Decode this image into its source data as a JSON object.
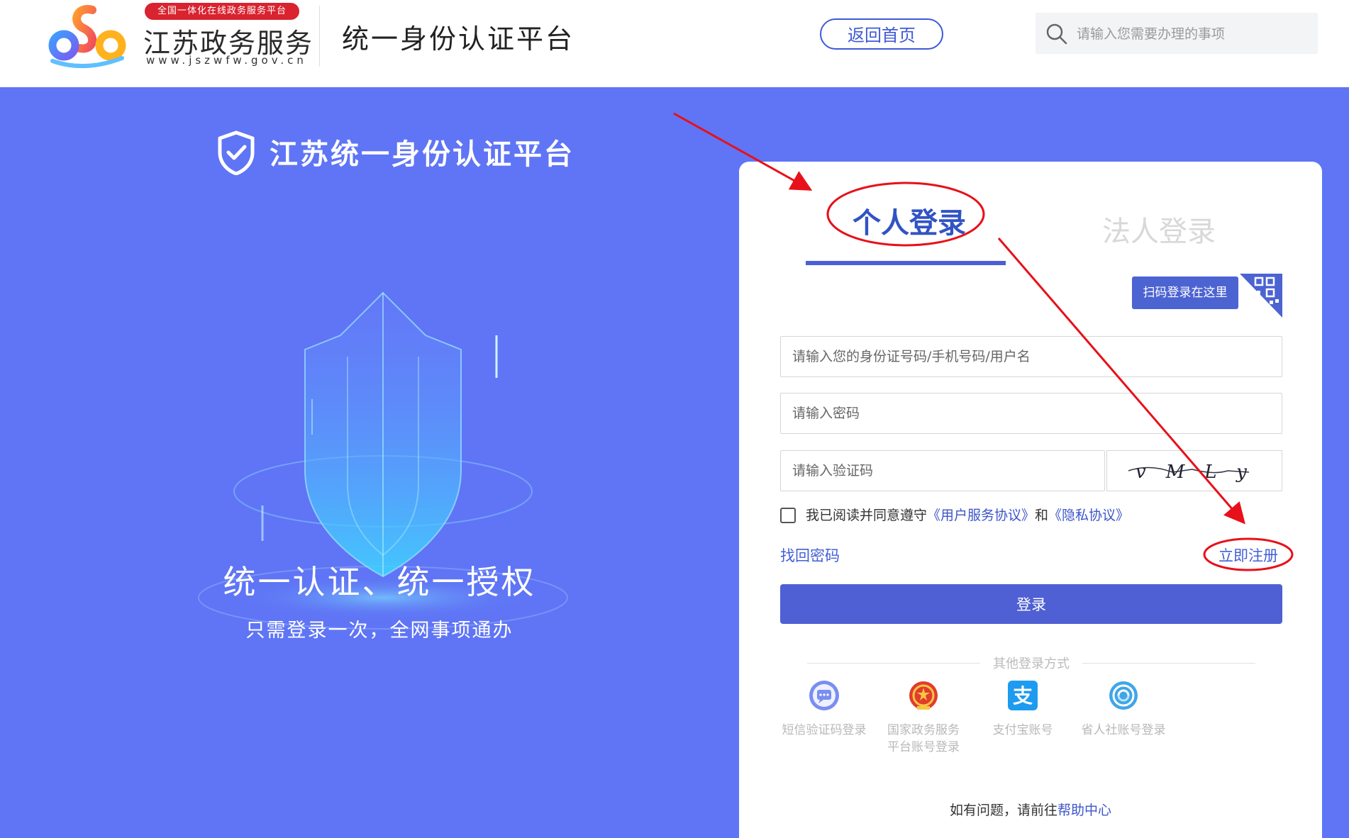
{
  "header": {
    "logo_badge": "全国一体化在线政务服务平台",
    "logo_title": "江苏政务服务",
    "logo_url": "www.jszwfw.gov.cn",
    "platform_title": "统一身份认证平台",
    "home_button": "返回首页",
    "search_placeholder": "请输入您需要办理的事项"
  },
  "hero": {
    "title": "江苏统一身份认证平台",
    "slogan": "统一认证、统一授权",
    "subtitle": "只需登录一次，全网事项通办"
  },
  "login": {
    "tabs": [
      {
        "label": "个人登录",
        "active": true
      },
      {
        "label": "法人登录",
        "active": false
      }
    ],
    "qr_badge": "扫码登录在这里",
    "username_placeholder": "请输入您的身份证号码/手机号码/用户名",
    "password_placeholder": "请输入密码",
    "captcha_placeholder": "请输入验证码",
    "captcha_text": "vMLy",
    "agree_prefix": "我已阅读并同意遵守",
    "agree_link1": "《用户服务协议》",
    "agree_and": "和",
    "agree_link2": "《隐私协议》",
    "agree_checked": false,
    "forgot": "找回密码",
    "register": "立即注册",
    "submit": "登录",
    "other_title": "其他登录方式",
    "other_methods": [
      {
        "label": "短信验证码登录",
        "icon": "sms-icon"
      },
      {
        "label": "国家政务服务平台账号登录",
        "label_line1": "国家政务服务",
        "label_line2": "平台账号登录",
        "icon": "national-emblem-icon"
      },
      {
        "label": "支付宝账号",
        "icon": "alipay-icon"
      },
      {
        "label": "省人社账号登录",
        "icon": "social-security-icon"
      }
    ],
    "help_prefix": "如有问题，请前往",
    "help_link": "帮助中心"
  },
  "colors": {
    "hero_bg": "#5f75f5",
    "primary": "#4e60d3",
    "link": "#4360d6",
    "annotation": "#e8101a",
    "badge_red": "#d9232f"
  }
}
